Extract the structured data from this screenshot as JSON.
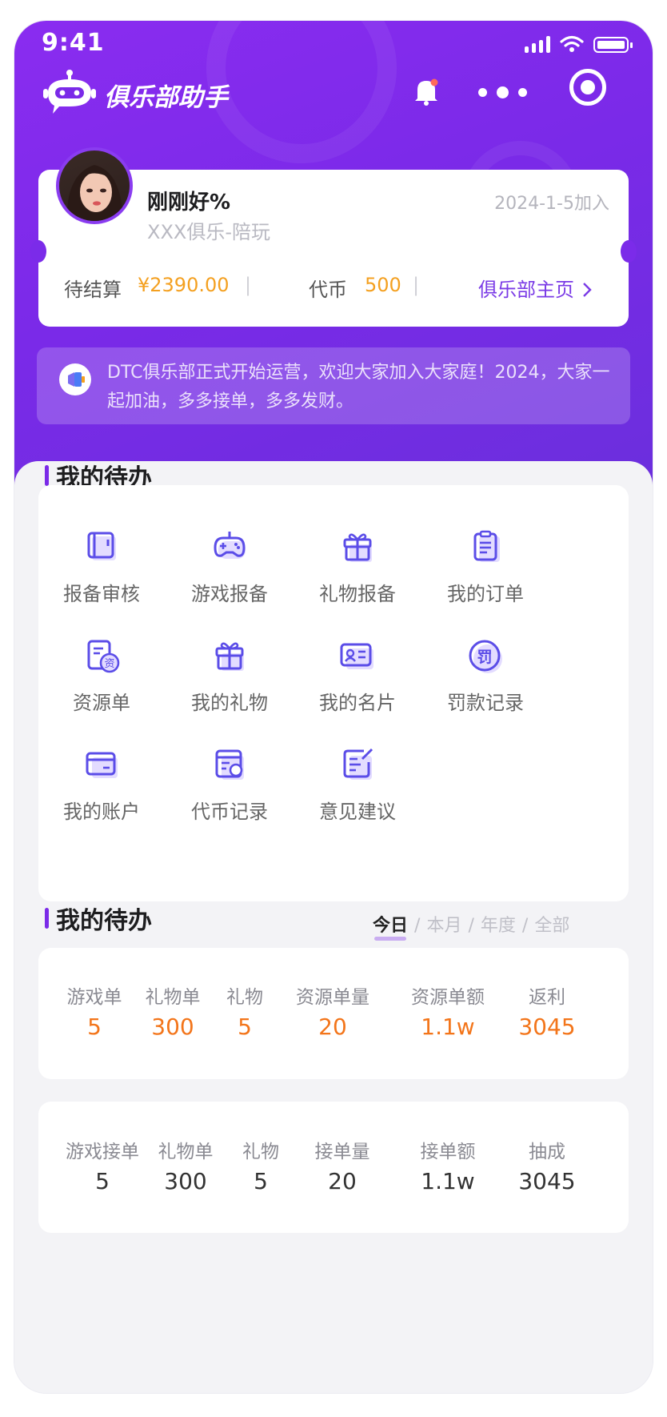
{
  "status_bar": {
    "time": "9:41"
  },
  "app_bar": {
    "title": "俱乐部助手"
  },
  "profile": {
    "name": "刚刚好%",
    "join_date": "2024-1-5加入",
    "club_role": "XXX俱乐-陪玩",
    "pending_label": "待结算",
    "pending_value": "¥2390.00",
    "coin_label": "代币",
    "coin_value": "500",
    "home_link": "俱乐部主页",
    "separator": "|"
  },
  "notice": {
    "text": "DTC俱乐部正式开始运营，欢迎大家加入大家庭！2024，大家一起加油，多多接单，多多发财。"
  },
  "todo": {
    "title": "我的待办",
    "items": [
      {
        "label": "报备审核",
        "icon": "folder-review-icon"
      },
      {
        "label": "游戏报备",
        "icon": "gamepad-icon"
      },
      {
        "label": "礼物报备",
        "icon": "gift-icon"
      },
      {
        "label": "我的订单",
        "icon": "clipboard-icon"
      },
      {
        "label": "资源单",
        "icon": "resource-document-icon"
      },
      {
        "label": "我的礼物",
        "icon": "gift-box-icon"
      },
      {
        "label": "我的名片",
        "icon": "id-card-icon"
      },
      {
        "label": "罚款记录",
        "icon": "fine-icon"
      },
      {
        "label": "我的账户",
        "icon": "wallet-icon"
      },
      {
        "label": "代币记录",
        "icon": "coin-record-icon"
      },
      {
        "label": "意见建议",
        "icon": "feedback-icon"
      }
    ],
    "fine_glyph": "罚",
    "resource_glyph": "资"
  },
  "stats": {
    "title": "我的待办",
    "tabs": [
      "今日",
      "本月",
      "年度",
      "全部"
    ],
    "active_tab": "今日",
    "tab_separator": "/",
    "row1": [
      {
        "label": "游戏单",
        "value": "5"
      },
      {
        "label": "礼物单",
        "value": "300"
      },
      {
        "label": "礼物",
        "value": "5"
      },
      {
        "label": "资源单量",
        "value": "20"
      },
      {
        "label": "资源单额",
        "value": "1.1w"
      },
      {
        "label": "返利",
        "value": "3045"
      }
    ],
    "row2": [
      {
        "label": "游戏接单",
        "value": "5"
      },
      {
        "label": "礼物单",
        "value": "300"
      },
      {
        "label": "礼物",
        "value": "5"
      },
      {
        "label": "接单量",
        "value": "20"
      },
      {
        "label": "接单额",
        "value": "1.1w"
      },
      {
        "label": "抽成",
        "value": "3045"
      }
    ]
  },
  "colors": {
    "brand": "#7a2ae8",
    "accent_orange": "#f3751a",
    "gold": "#f4a020"
  }
}
